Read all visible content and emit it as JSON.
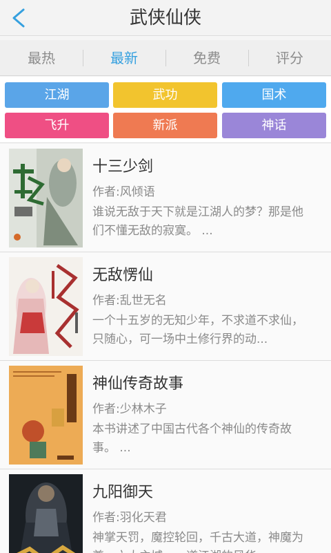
{
  "header": {
    "title": "武侠仙侠",
    "back_icon": "chevron-left-icon",
    "accent": "#35a0df"
  },
  "tabs": [
    {
      "label": "最热",
      "active": false
    },
    {
      "label": "最新",
      "active": true
    },
    {
      "label": "免费",
      "active": false
    },
    {
      "label": "评分",
      "active": false
    }
  ],
  "categories": [
    {
      "label": "江湖",
      "color": "#5aa5e8"
    },
    {
      "label": "武功",
      "color": "#f2c42e"
    },
    {
      "label": "国术",
      "color": "#4fa9ee"
    },
    {
      "label": "飞升",
      "color": "#ef4f84"
    },
    {
      "label": "新派",
      "color": "#ef7a52"
    },
    {
      "label": "神话",
      "color": "#9a86d8"
    }
  ],
  "books": [
    {
      "title": "十三少剑",
      "author": "作者:风倾语",
      "description": "谁说无敌于天下就是江湖人的梦？那是他们不懂无敌的寂寞。 ..."
    },
    {
      "title": "无敌愣仙",
      "author": "作者:乱世无名",
      "description": "一个十五岁的无知少年，不求道不求仙，只随心，可一场中土修行界的动..."
    },
    {
      "title": "神仙传奇故事",
      "author": "作者:少林木子",
      "description": "本书讲述了中国古代各个神仙的传奇故事。 ..."
    },
    {
      "title": "九阳御天",
      "author": "作者:羽化天君",
      "description": "神掌天罚，魔控轮回，千古大道，神魔为尊。六大主城，一道江湖的风华..."
    }
  ]
}
